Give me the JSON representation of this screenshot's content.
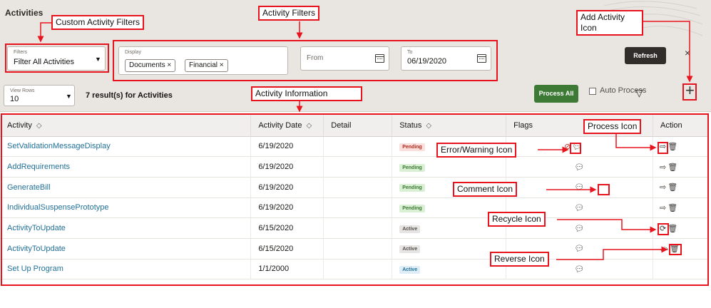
{
  "page": {
    "title": "Activities"
  },
  "filters": {
    "filters_label": "Filters",
    "filters_value": "Filter All Activities",
    "display_label": "Display",
    "display_chips": [
      "Documents ×",
      "Financial ×"
    ],
    "from_placeholder": "From",
    "to_label": "To",
    "to_value": "06/19/2020",
    "refresh_label": "Refresh"
  },
  "toolbar": {
    "view_rows_label": "View Rows",
    "view_rows_value": "10",
    "results_text": "7 result(s) for Activities",
    "process_all_label": "Process All",
    "auto_process_label": "Auto Process"
  },
  "table": {
    "headers": [
      "Activity",
      "Activity Date",
      "Detail",
      "Status",
      "Flags",
      "Action"
    ],
    "rows": [
      {
        "activity": "SetValidationMessageDisplay",
        "date": "6/19/2020",
        "status": "Pending"
      },
      {
        "activity": "AddRequirements",
        "date": "6/19/2020",
        "status": "Pending"
      },
      {
        "activity": "GenerateBill",
        "date": "6/19/2020",
        "status": "Pending"
      },
      {
        "activity": "IndividualSuspensePrototype",
        "date": "6/19/2020",
        "status": "Pending"
      },
      {
        "activity": "ActivityToUpdate",
        "date": "6/15/2020",
        "status": "Active"
      },
      {
        "activity": "ActivityToUpdate",
        "date": "6/15/2020",
        "status": "Active"
      },
      {
        "activity": "Set Up Program",
        "date": "1/1/2000",
        "status": "Active"
      }
    ]
  },
  "annotations": {
    "custom_filters": "Custom Activity Filters",
    "activity_filters": "Activity Filters",
    "add_activity": "Add Activity Icon",
    "activity_information": "Activity Information",
    "process_icon": "Process Icon",
    "error_icon": "Error/Warning Icon",
    "comment_icon": "Comment Icon",
    "recycle_icon": "Recycle Icon",
    "reverse_icon": "Reverse Icon"
  },
  "colors": {
    "accent": "#e8141d",
    "link": "#227199",
    "pending_bg": "#d9f0d4",
    "pending_text": "#3d7a35",
    "active_bg": "#e7e5e3",
    "active_text": "#55504b",
    "active_blue_bg": "#dfeef6",
    "active_blue_text": "#227199",
    "refresh_bg": "#312d2a",
    "process_all_bg": "#3d7a35"
  },
  "icons": [
    "chevron-down-icon",
    "calendar-icon",
    "close-icon",
    "sort-icon",
    "funnel-icon",
    "plus-icon",
    "error-icon",
    "comment-icon",
    "process-icon",
    "delete-icon",
    "recycle-icon",
    "reverse-icon"
  ]
}
